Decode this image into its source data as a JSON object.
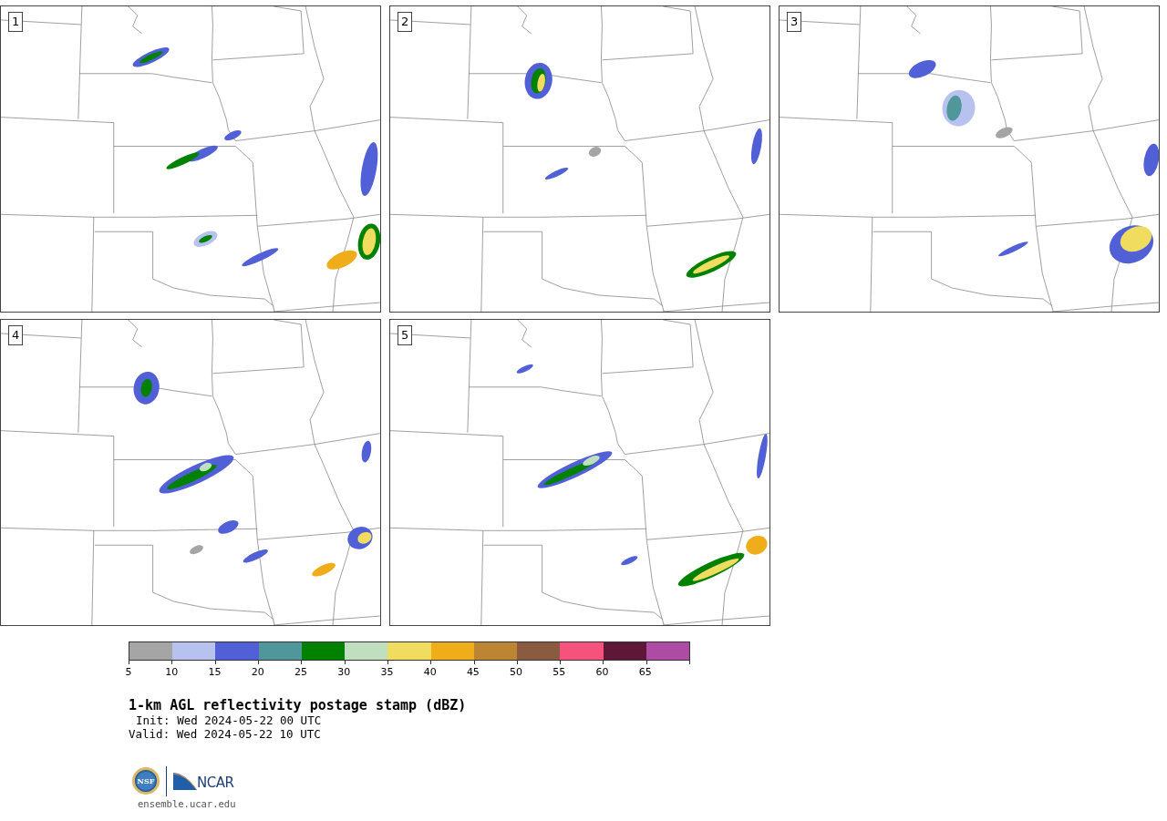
{
  "panels": [
    {
      "label": "1"
    },
    {
      "label": "2"
    },
    {
      "label": "3"
    },
    {
      "label": "4"
    },
    {
      "label": "5"
    }
  ],
  "colorbar": {
    "bins": [
      {
        "color": "#a5a5a5"
      },
      {
        "color": "#b8c2ee"
      },
      {
        "color": "#5160d6"
      },
      {
        "color": "#50979c"
      },
      {
        "color": "#008200"
      },
      {
        "color": "#bfdfbf"
      },
      {
        "color": "#f0dc5e"
      },
      {
        "color": "#f0ad1a"
      },
      {
        "color": "#bb8533"
      },
      {
        "color": "#8a5b40"
      },
      {
        "color": "#f5527e"
      },
      {
        "color": "#5e1737"
      },
      {
        "color": "#ae4ba4"
      }
    ],
    "ticks": [
      "5",
      "10",
      "15",
      "20",
      "25",
      "30",
      "35",
      "40",
      "45",
      "50",
      "55",
      "60",
      "65"
    ]
  },
  "title": "1-km AGL reflectivity postage stamp (dBZ)",
  "init": "Init: Wed 2024-05-22 00 UTC",
  "valid": "Valid: Wed 2024-05-22 10 UTC",
  "logos": {
    "nsf": "NSF",
    "ncar": "NCAR"
  },
  "url": "ensemble.ucar.edu"
}
